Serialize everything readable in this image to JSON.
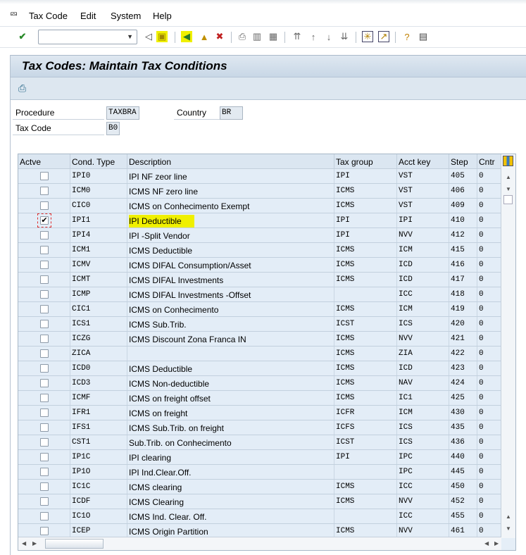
{
  "menu": {
    "items": [
      "Tax Code",
      "Edit",
      "System",
      "Help"
    ]
  },
  "toolbar": {
    "command_field": "",
    "icons": [
      "enter-icon",
      "back-triangle-icon",
      "save-icon",
      "back-icon",
      "exit-icon",
      "cancel-icon",
      "print-icon",
      "find-icon",
      "find-next-icon",
      "first-page-icon",
      "previous-page-icon",
      "next-page-icon",
      "last-page-icon",
      "new-session-icon",
      "shortcut-icon",
      "help-icon",
      "customize-layout-icon"
    ]
  },
  "screen": {
    "title": "Tax Codes: Maintain Tax Conditions"
  },
  "header_fields": {
    "procedure_label": "Procedure",
    "procedure_value": "TAXBRA",
    "country_label": "Country",
    "country_value": "BR",
    "tax_code_label": "Tax Code",
    "tax_code_value": "B0"
  },
  "table": {
    "columns": [
      "Actve",
      "Cond. Type",
      "Description",
      "Tax group",
      "Acct key",
      "Step",
      "Cntr"
    ],
    "rows": [
      {
        "active": false,
        "cond": "IPI0",
        "desc": "IPI NF zeor line",
        "group": "IPI",
        "acct": "VST",
        "step": "405",
        "cntr": "0"
      },
      {
        "active": false,
        "cond": "ICM0",
        "desc": "ICMS NF zero line",
        "group": "ICMS",
        "acct": "VST",
        "step": "406",
        "cntr": "0"
      },
      {
        "active": false,
        "cond": "CIC0",
        "desc": "ICMS on Conhecimento Exempt",
        "group": "ICMS",
        "acct": "VST",
        "step": "409",
        "cntr": "0"
      },
      {
        "active": true,
        "cond": "IPI1",
        "desc": "IPI  Deductible",
        "group": "IPI",
        "acct": "IPI",
        "step": "410",
        "cntr": "0",
        "highlight": true
      },
      {
        "active": false,
        "cond": "IPI4",
        "desc": "IPI -Split Vendor",
        "group": "IPI",
        "acct": "NVV",
        "step": "412",
        "cntr": "0"
      },
      {
        "active": false,
        "cond": "ICM1",
        "desc": "ICMS Deductible",
        "group": "ICMS",
        "acct": "ICM",
        "step": "415",
        "cntr": "0"
      },
      {
        "active": false,
        "cond": "ICMV",
        "desc": "ICMS DIFAL Consumption/Asset",
        "group": "ICMS",
        "acct": "ICD",
        "step": "416",
        "cntr": "0"
      },
      {
        "active": false,
        "cond": "ICMT",
        "desc": "ICMS DIFAL Investments",
        "group": "ICMS",
        "acct": "ICD",
        "step": "417",
        "cntr": "0"
      },
      {
        "active": false,
        "cond": "ICMP",
        "desc": "ICMS DIFAL Investments -Offset",
        "group": "",
        "acct": "ICC",
        "step": "418",
        "cntr": "0"
      },
      {
        "active": false,
        "cond": "CIC1",
        "desc": "ICMS on Conhecimento",
        "group": "ICMS",
        "acct": "ICM",
        "step": "419",
        "cntr": "0"
      },
      {
        "active": false,
        "cond": "ICS1",
        "desc": "ICMS Sub.Trib.",
        "group": "ICST",
        "acct": "ICS",
        "step": "420",
        "cntr": "0"
      },
      {
        "active": false,
        "cond": "ICZG",
        "desc": "ICMS Discount Zona Franca IN",
        "group": "ICMS",
        "acct": "NVV",
        "step": "421",
        "cntr": "0"
      },
      {
        "active": false,
        "cond": "ZICA",
        "desc": "",
        "group": "ICMS",
        "acct": "ZIA",
        "step": "422",
        "cntr": "0"
      },
      {
        "active": false,
        "cond": "ICD0",
        "desc": "ICMS Deductible",
        "group": "ICMS",
        "acct": "ICD",
        "step": "423",
        "cntr": "0"
      },
      {
        "active": false,
        "cond": "ICD3",
        "desc": "ICMS Non-deductible",
        "group": "ICMS",
        "acct": "NAV",
        "step": "424",
        "cntr": "0"
      },
      {
        "active": false,
        "cond": "ICMF",
        "desc": "ICMS on freight offset",
        "group": "ICMS",
        "acct": "IC1",
        "step": "425",
        "cntr": "0"
      },
      {
        "active": false,
        "cond": "IFR1",
        "desc": "ICMS on freight",
        "group": "ICFR",
        "acct": "ICM",
        "step": "430",
        "cntr": "0"
      },
      {
        "active": false,
        "cond": "IFS1",
        "desc": "ICMS Sub.Trib. on freight",
        "group": "ICFS",
        "acct": "ICS",
        "step": "435",
        "cntr": "0"
      },
      {
        "active": false,
        "cond": "CST1",
        "desc": "Sub.Trib. on Conhecimento",
        "group": "ICST",
        "acct": "ICS",
        "step": "436",
        "cntr": "0"
      },
      {
        "active": false,
        "cond": "IP1C",
        "desc": "IPI  clearing",
        "group": "IPI",
        "acct": "IPC",
        "step": "440",
        "cntr": "0"
      },
      {
        "active": false,
        "cond": "IP1O",
        "desc": "IPI Ind.Clear.Off.",
        "group": "",
        "acct": "IPC",
        "step": "445",
        "cntr": "0"
      },
      {
        "active": false,
        "cond": "IC1C",
        "desc": "ICMS clearing",
        "group": "ICMS",
        "acct": "ICC",
        "step": "450",
        "cntr": "0"
      },
      {
        "active": false,
        "cond": "ICDF",
        "desc": "ICMS Clearing",
        "group": "ICMS",
        "acct": "NVV",
        "step": "452",
        "cntr": "0"
      },
      {
        "active": false,
        "cond": "IC1O",
        "desc": "ICMS Ind. Clear. Off.",
        "group": "",
        "acct": "ICC",
        "step": "455",
        "cntr": "0"
      },
      {
        "active": false,
        "cond": "ICEP",
        "desc": "ICMS Origin Partition",
        "group": "ICMS",
        "acct": "NVV",
        "step": "461",
        "cntr": "0"
      }
    ]
  },
  "colors": {
    "highlight": "#f0f000",
    "title_band": "#c8d7e6",
    "table_bg": "#e3edf7"
  }
}
